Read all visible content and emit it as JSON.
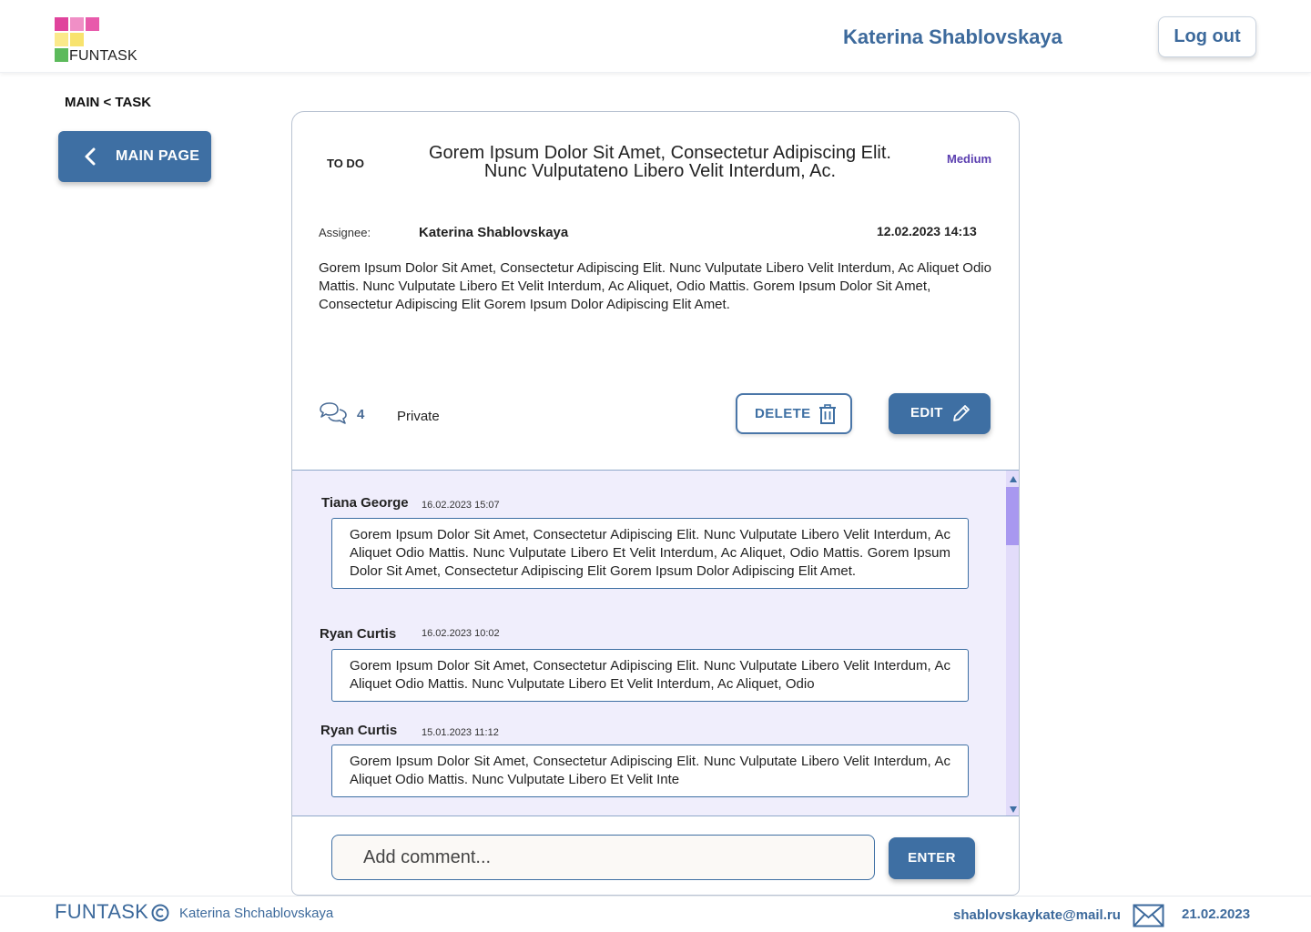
{
  "header": {
    "logo_text": "FUNTASK",
    "user_name": "Katerina Shablovskaya",
    "logout_label": "Log out"
  },
  "nav": {
    "breadcrumb": "MAIN < TASK",
    "main_page_label": "MAIN PAGE"
  },
  "task": {
    "status": "TO DO",
    "title": "Gorem Ipsum Dolor Sit Amet, Consectetur Adipiscing Elit. Nunc Vulputateno Libero Velit Interdum, Ac.",
    "priority": "Medium",
    "assignee_label": "Assignee:",
    "assignee": "Katerina Shablovskaya",
    "date": "12.02.2023 14:13",
    "description": "Gorem Ipsum Dolor Sit Amet, Consectetur Adipiscing Elit. Nunc Vulputate Libero Velit Interdum, Ac Aliquet Odio Mattis. Nunc Vulputate Libero Et Velit Interdum, Ac Aliquet, Odio Mattis. Gorem Ipsum Dolor Sit Amet, Consectetur Adipiscing Elit Gorem Ipsum Dolor Adipiscing Elit Amet.",
    "comment_count": "4",
    "privacy": "Private",
    "delete_label": "DELETE",
    "edit_label": "EDIT"
  },
  "comments": [
    {
      "author": "Tiana George",
      "date": "16.02.2023 15:07",
      "text": "Gorem Ipsum Dolor Sit Amet, Consectetur Adipiscing Elit. Nunc Vulputate Libero Velit Interdum, Ac Aliquet Odio Mattis. Nunc Vulputate Libero Et Velit Interdum, Ac Aliquet, Odio Mattis. Gorem Ipsum Dolor Sit Amet, Consectetur Adipiscing Elit Gorem Ipsum Dolor Adipiscing Elit Amet."
    },
    {
      "author": "Ryan Curtis",
      "date": "16.02.2023 10:02",
      "text": "Gorem Ipsum Dolor Sit Amet, Consectetur Adipiscing Elit. Nunc Vulputate Libero Velit Interdum, Ac Aliquet Odio Mattis. Nunc Vulputate Libero Et Velit Interdum, Ac Aliquet, Odio"
    },
    {
      "author": "Ryan Curtis",
      "date": "15.01.2023 11:12",
      "text": "Gorem Ipsum Dolor Sit Amet, Consectetur Adipiscing Elit. Nunc Vulputate Libero Velit Interdum, Ac Aliquet Odio Mattis. Nunc Vulputate Libero Et Velit Inte"
    }
  ],
  "composer": {
    "placeholder": "Add comment...",
    "enter_label": "ENTER"
  },
  "footer": {
    "brand": "FUNTASK",
    "author": "Katerina Shchablovskaya",
    "email": "shablovskaykate@mail.ru",
    "date": "21.02.2023"
  },
  "colors": {
    "accent": "#3e6fa3",
    "brand_text": "#3d6a9c",
    "priority": "#5b3fb0",
    "comments_bg": "#f0eefc",
    "logo_pink": "#e0439c",
    "logo_light_pink": "#f08fc6",
    "logo_yellow": "#fbe98b",
    "logo_green": "#5cba5b"
  },
  "icons": {
    "back": "chevron-left-icon",
    "comments": "speech-bubbles-icon",
    "delete": "trash-icon",
    "edit": "pencil-icon",
    "copyright": "copyright-icon",
    "mail": "envelope-icon"
  }
}
